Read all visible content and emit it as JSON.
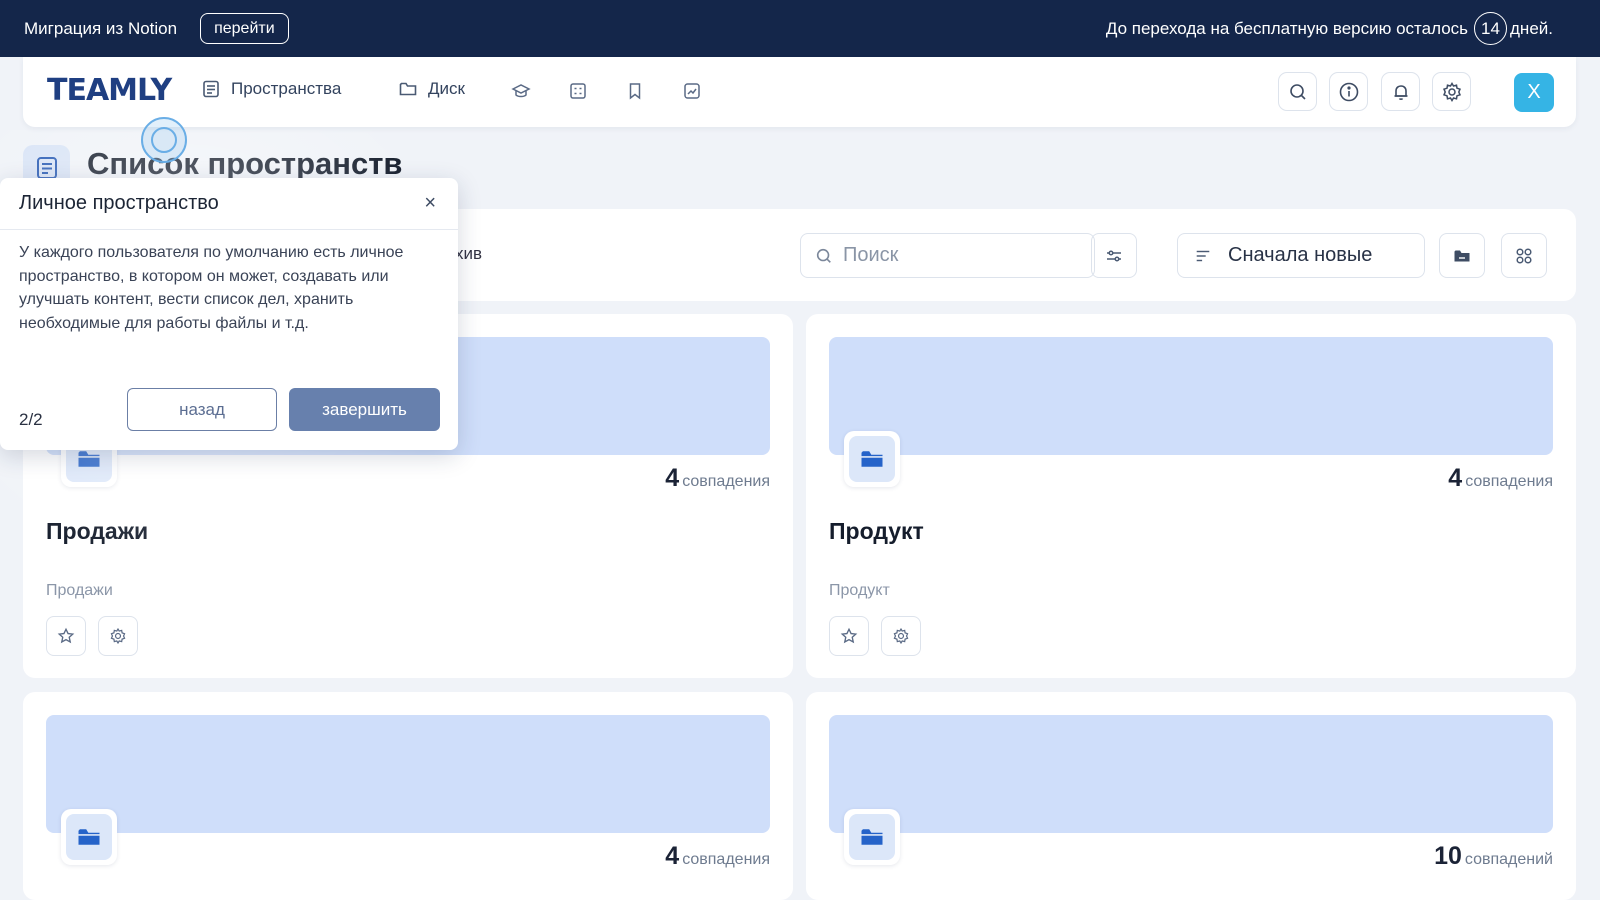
{
  "banner": {
    "migration_text": "Миграция из Notion",
    "go_label": "перейти",
    "trial_prefix": "До перехода на бесплатную версию осталось",
    "days": "14",
    "trial_suffix": "дней."
  },
  "navbar": {
    "logo": "TEAMLY",
    "items": [
      {
        "label": "Пространства",
        "icon": "spaces-icon"
      },
      {
        "label": "Диск",
        "icon": "folder-icon"
      }
    ],
    "icon_items": [
      "graduation-cap-icon",
      "grid-icon",
      "bookmark-icon",
      "chart-icon"
    ],
    "buttons": [
      "search-icon",
      "info-icon",
      "bell-icon",
      "gear-icon"
    ],
    "avatar_initial": "X"
  },
  "page": {
    "title": "Список пространств"
  },
  "toolbar": {
    "archive_label": "хив",
    "search_placeholder": "Поиск",
    "sort_label": "Сначала новые"
  },
  "cards": [
    {
      "name": "Продажи",
      "description": "Продажи",
      "count": "4",
      "count_word": "совпадения"
    },
    {
      "name": "Продукт",
      "description": "Продукт",
      "count": "4",
      "count_word": "совпадения"
    },
    {
      "name": "",
      "description": "",
      "count": "4",
      "count_word": "совпадения"
    },
    {
      "name": "",
      "description": "",
      "count": "10",
      "count_word": "совпадений"
    }
  ],
  "tour": {
    "title": "Личное пространство",
    "close": "×",
    "body": "У каждого пользователя по умолчанию есть личное пространство, в котором он может, создавать или улучшать контент, вести список дел, хранить необходимые для работы файлы и т.д.",
    "step": "2/2",
    "back_label": "назад",
    "finish_label": "завершить"
  },
  "colors": {
    "banner_bg": "#14264a",
    "card_banner": "#cfdefa",
    "avatar": "#35b4e5",
    "primary_button": "#6780ad"
  }
}
